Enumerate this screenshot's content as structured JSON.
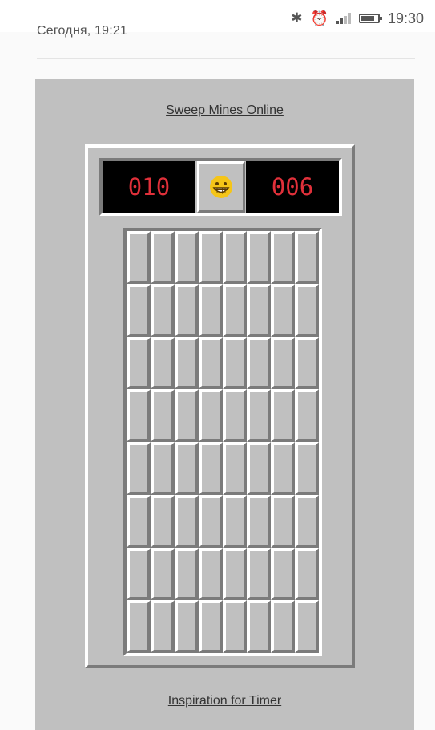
{
  "status_bar": {
    "time": "19:30",
    "icons": [
      "bluetooth-icon",
      "alarm-clock-icon",
      "signal-icon",
      "battery-icon"
    ]
  },
  "header_text": {
    "date": "Сегодня, 19:21"
  },
  "links": {
    "top": "Sweep Mines Online",
    "bottom": "Inspiration for Timer"
  },
  "game": {
    "mine_counter": "010",
    "timer": "006",
    "face": "grinning-face-icon",
    "rows": 8,
    "columns": 8,
    "colors": {
      "panel": "#c0c0c0",
      "shadow": "#7b7b7b",
      "highlight": "#ffffff",
      "display_bg": "#000000",
      "display_digits": "#e0303a",
      "face": "#f5c518"
    }
  }
}
